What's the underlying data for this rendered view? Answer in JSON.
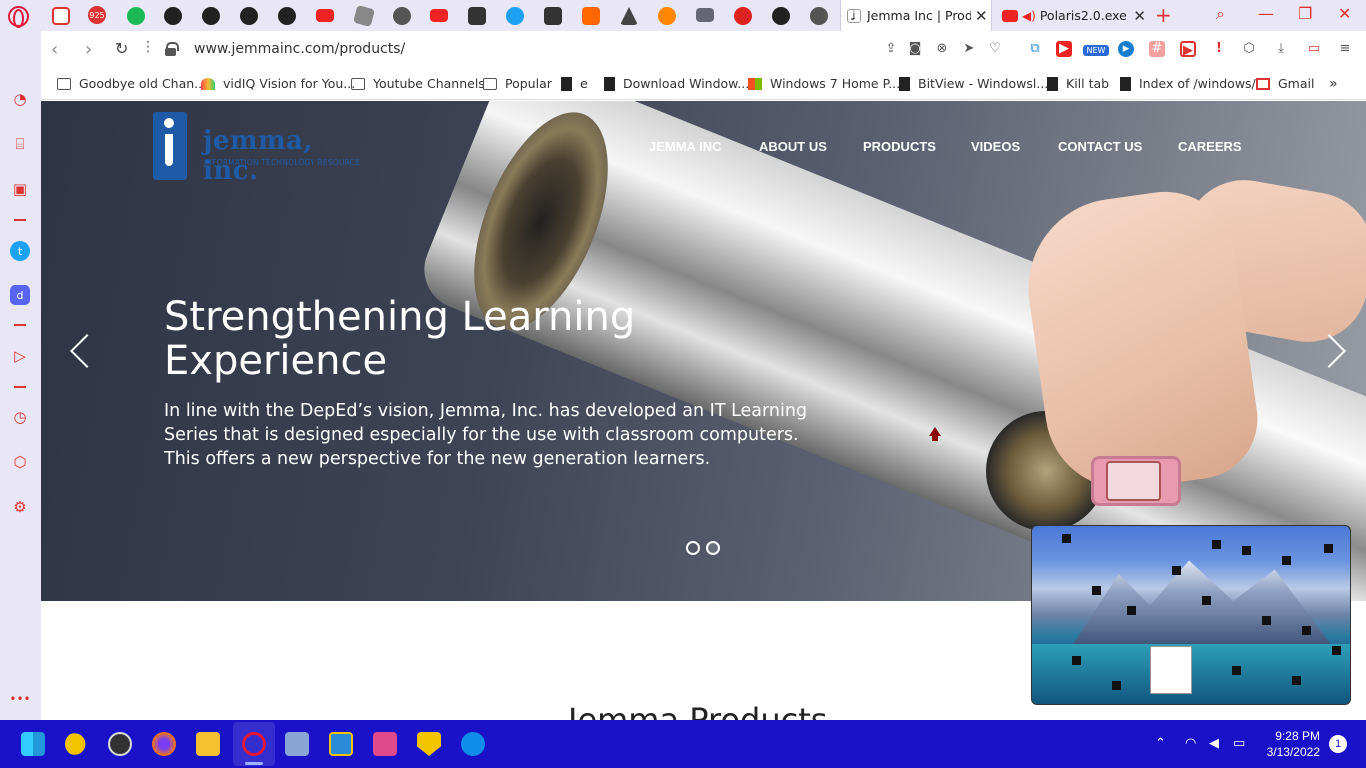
{
  "browser": {
    "active_tab_title": "Jemma Inc | Produc",
    "second_tab_title": "Polaris2.0.exe -",
    "pinned_badge": "925",
    "url": "www.jemmainc.com/products/",
    "extension_badge": "NEW"
  },
  "bookmarks": [
    {
      "label": "Goodbye old Chan...",
      "icon": "folder"
    },
    {
      "label": "vidIQ Vision for You...",
      "icon": "vidiq"
    },
    {
      "label": "Youtube Channels",
      "icon": "folder"
    },
    {
      "label": "Popular",
      "icon": "folder"
    },
    {
      "label": "e",
      "icon": "file"
    },
    {
      "label": "Download Window...",
      "icon": "file"
    },
    {
      "label": "Windows 7 Home P...",
      "icon": "windows"
    },
    {
      "label": "BitView - Windowsl...",
      "icon": "file"
    },
    {
      "label": "Kill tab",
      "icon": "file"
    },
    {
      "label": "Index of /windows/",
      "icon": "file"
    },
    {
      "label": "Gmail",
      "icon": "gmail"
    }
  ],
  "site": {
    "logo_text": "jemma, inc.",
    "logo_subtitle": "INFORMATION TECHNOLOGY RESOURCE",
    "nav": [
      "JEMMA INC",
      "ABOUT US",
      "PRODUCTS",
      "VIDEOS",
      "CONTACT US",
      "CAREERS"
    ],
    "hero_title": "Strengthening Learning Experience",
    "hero_text": "In line with the DepEd’s vision, Jemma, Inc. has developed an IT Learning Series that is designed especially for the use with classroom computers. This offers a new perspective for the new generation learners.",
    "section_title": "Jemma Products",
    "slide_count": 2,
    "active_slide": 2
  },
  "taskbar": {
    "time": "9:28 PM",
    "date": "3/13/2022",
    "notifications": "1"
  },
  "colors": {
    "brand_blue": "#1f5aa6",
    "opera_red": "#e0173b",
    "taskbar": "#1a12c9"
  }
}
